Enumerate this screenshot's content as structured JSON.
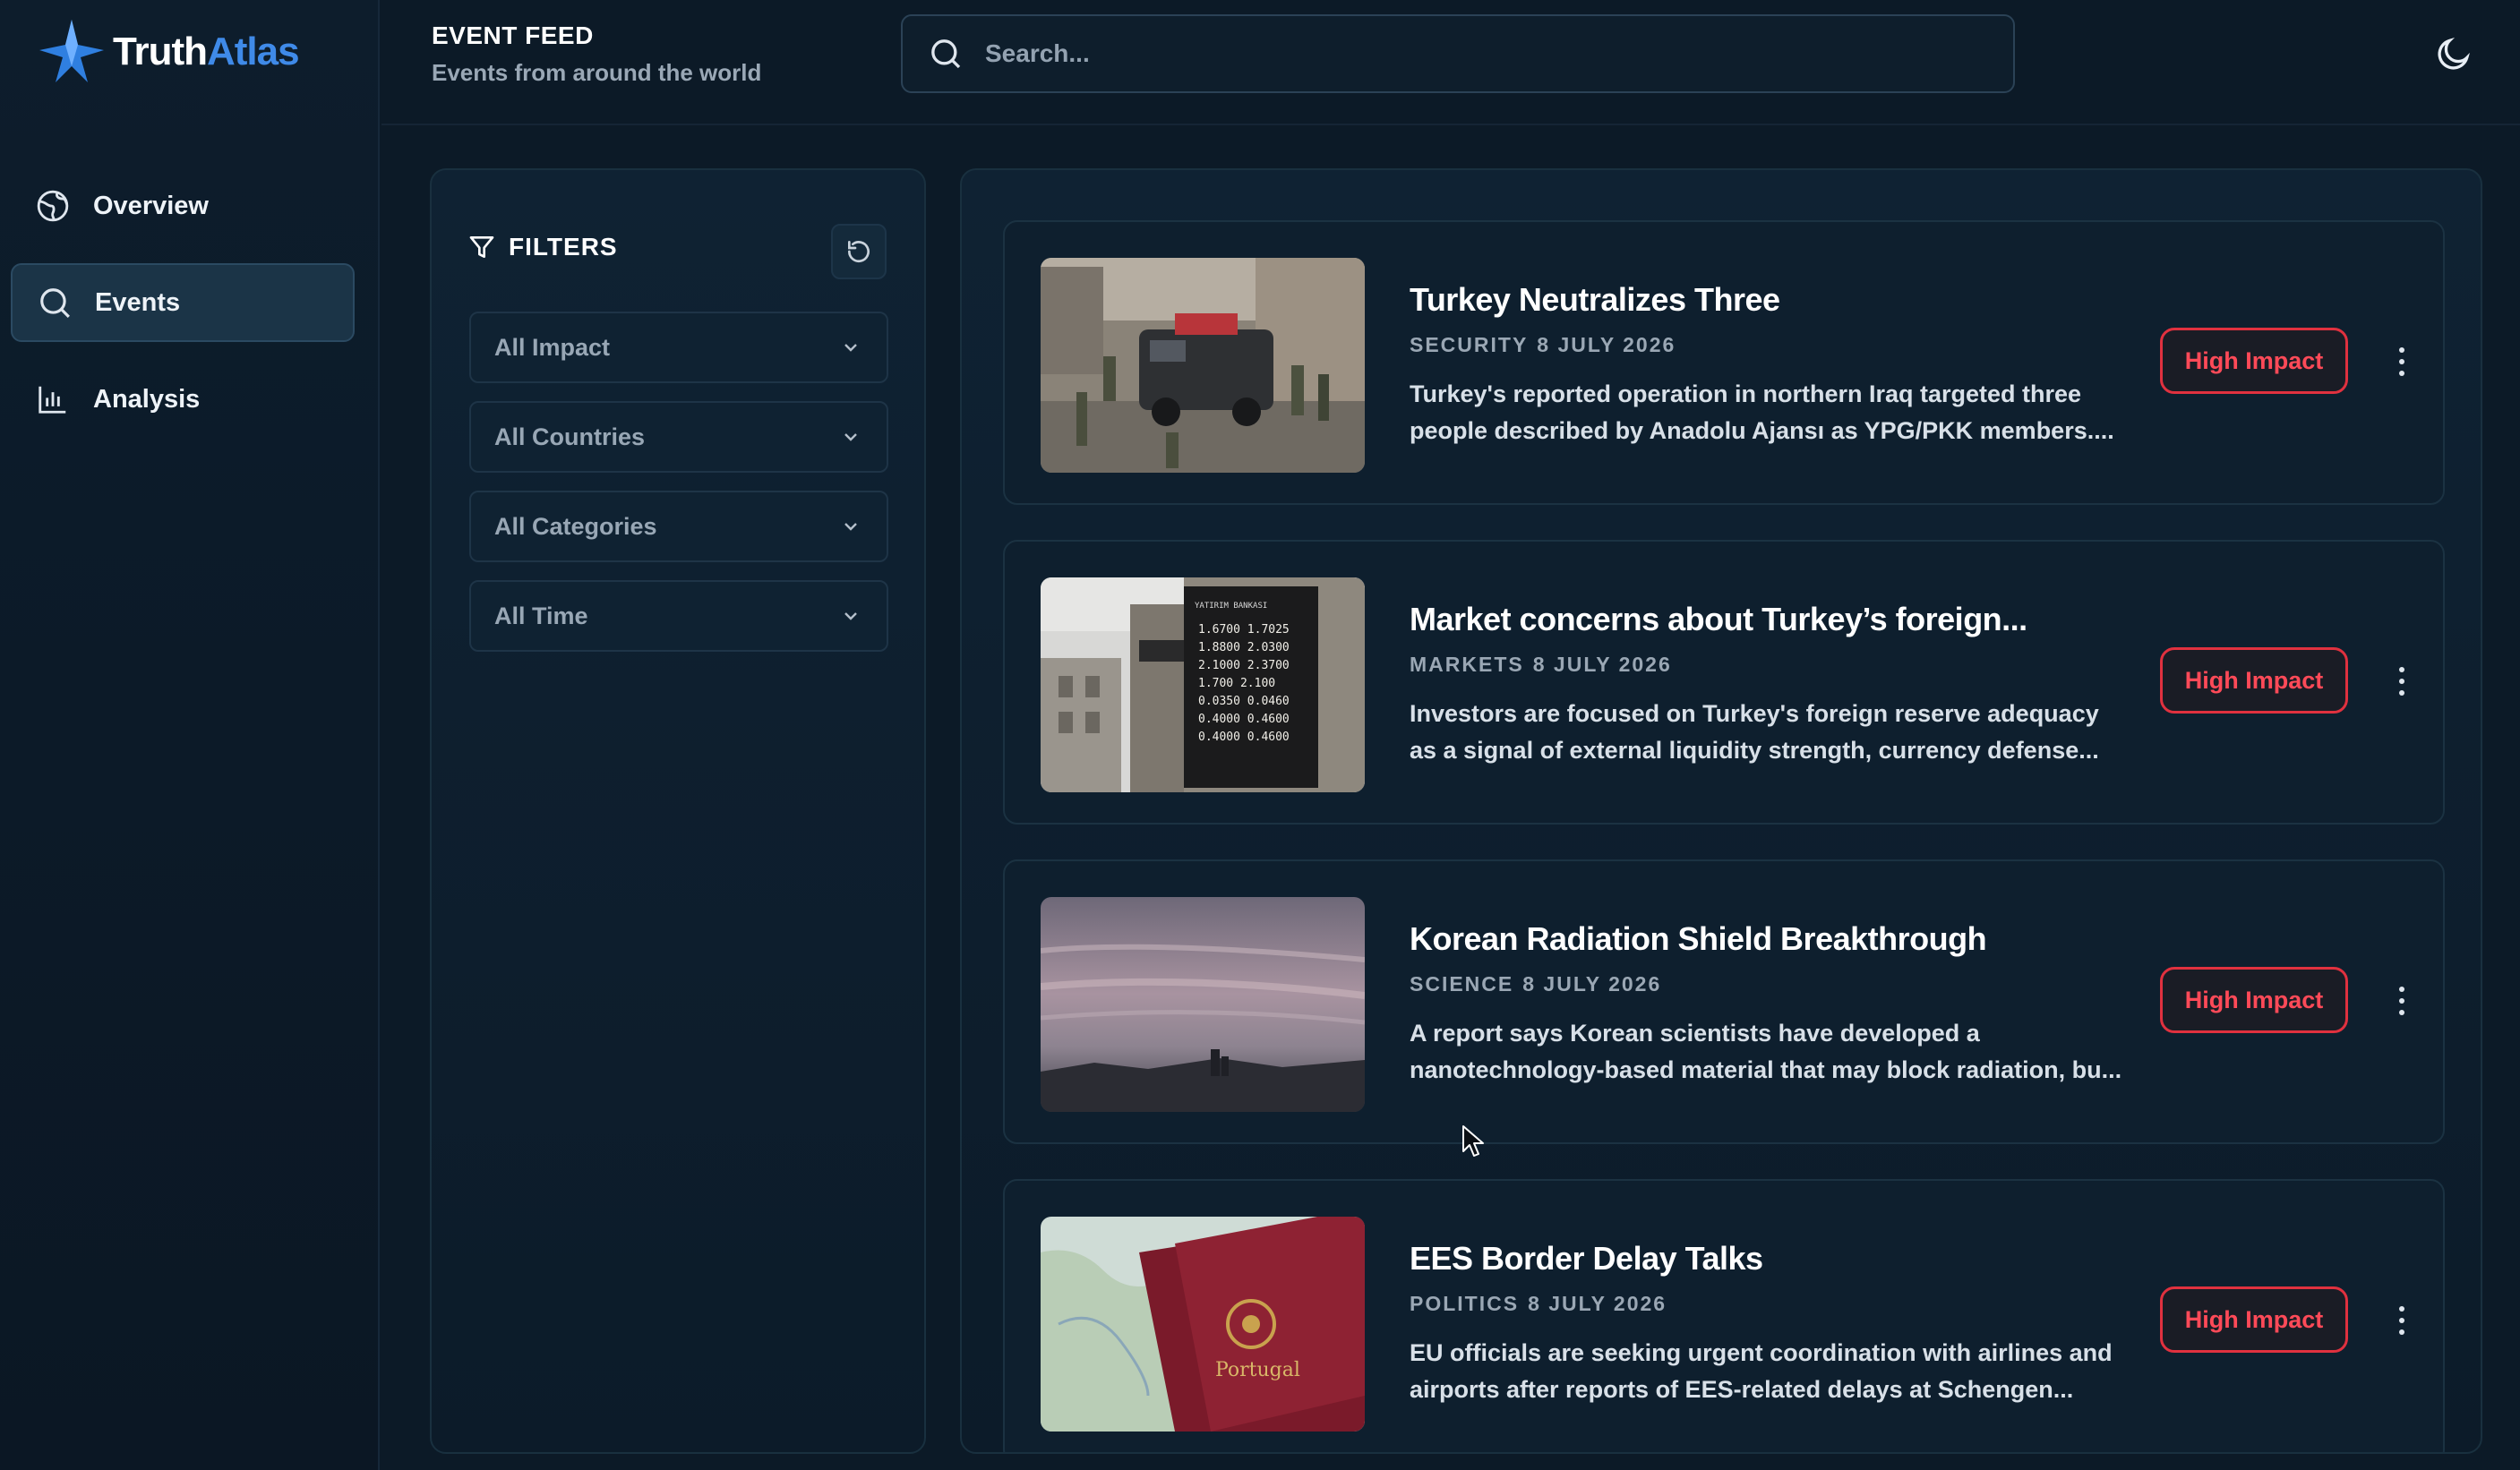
{
  "app": {
    "logo_word1": "Truth",
    "logo_word2": "Atlas"
  },
  "sidebar": {
    "items": [
      {
        "label": "Overview",
        "icon": "globe-icon",
        "active": false
      },
      {
        "label": "Events",
        "icon": "search-icon",
        "active": true
      },
      {
        "label": "Analysis",
        "icon": "bar-chart-icon",
        "active": false
      }
    ]
  },
  "header": {
    "title": "EVENT FEED",
    "subtitle": "Events from around the world",
    "search_placeholder": "Search...",
    "theme_icon": "moon-icon"
  },
  "filters": {
    "heading": "FILTERS",
    "selects": [
      {
        "value": "All Impact"
      },
      {
        "value": "All Countries"
      },
      {
        "value": "All Categories"
      },
      {
        "value": "All Time"
      }
    ]
  },
  "events": [
    {
      "title": "Turkey Neutralizes Three",
      "category": "SECURITY",
      "date": "8 JULY 2026",
      "description": "Turkey's reported operation in northern Iraq targeted three people described by Anadolu Ajansı as YPG/PKK members....",
      "impact": "High Impact"
    },
    {
      "title": "Market concerns about Turkey’s foreign...",
      "category": "MARKETS",
      "date": "8 JULY 2026",
      "description": "Investors are focused on Turkey's foreign reserve adequacy as a signal of external liquidity strength, currency defense...",
      "impact": "High Impact",
      "rates_board": [
        "1.6700 1.7025",
        "1.8800 2.0300",
        "2.1000 2.3700",
        "1.700 2.100",
        "0.0350 0.0460",
        "0.4000 0.4600",
        "0.4000 0.4600"
      ]
    },
    {
      "title": "Korean Radiation Shield Breakthrough",
      "category": "SCIENCE",
      "date": "8 JULY 2026",
      "description": "A report says Korean scientists have developed a nanotechnology-based material that may block radiation, bu...",
      "impact": "High Impact"
    },
    {
      "title": "EES Border Delay Talks",
      "category": "POLITICS",
      "date": "8 JULY 2026",
      "description": "EU officials are seeking urgent coordination with airlines and airports after reports of EES-related delays at Schengen...",
      "impact": "High Impact",
      "passport_text": "Portugal"
    }
  ],
  "colors": {
    "background": "#0c1a27",
    "accent_blue": "#3f8ae8",
    "impact_red": "#e0313f"
  }
}
